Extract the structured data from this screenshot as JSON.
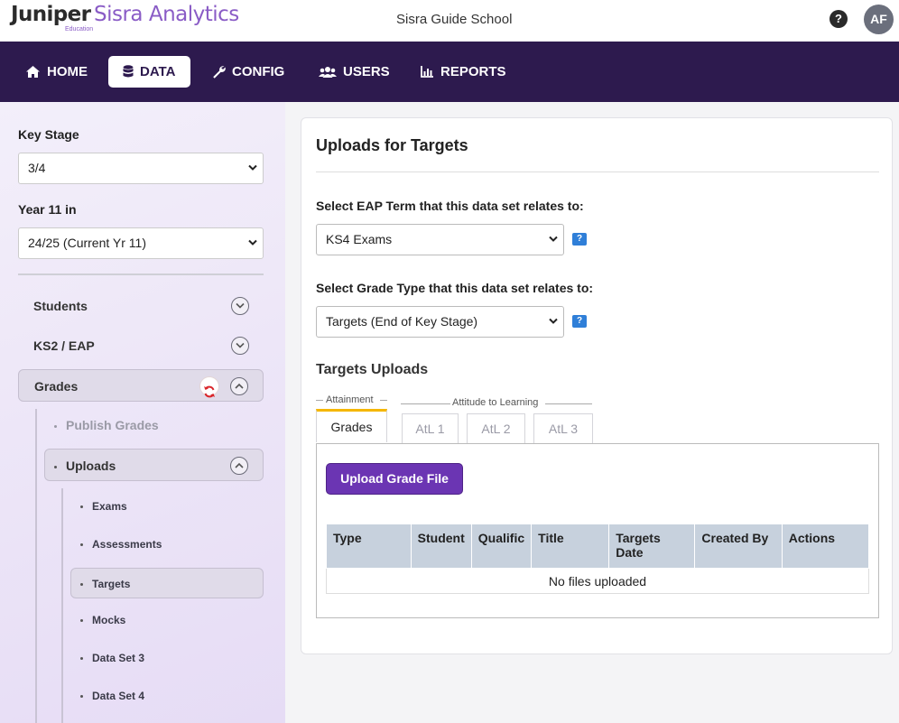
{
  "header": {
    "brand_name": "Juniper",
    "brand_sub": "Education",
    "app_name": "Sisra Analytics",
    "school_name": "Sisra Guide School",
    "help_label": "?",
    "avatar_initials": "AF"
  },
  "nav": {
    "items": [
      {
        "label": "HOME",
        "icon": "home-icon"
      },
      {
        "label": "DATA",
        "icon": "database-icon",
        "active": true
      },
      {
        "label": "CONFIG",
        "icon": "wrench-icon"
      },
      {
        "label": "USERS",
        "icon": "users-icon"
      },
      {
        "label": "REPORTS",
        "icon": "chart-icon"
      }
    ]
  },
  "sidebar": {
    "key_stage_label": "Key Stage",
    "key_stage_value": "3/4",
    "year_label": "Year 11 in",
    "year_value": "24/25 (Current Yr 11)",
    "sections": [
      {
        "label": "Students"
      },
      {
        "label": "KS2 / EAP"
      },
      {
        "label": "Grades",
        "open": true
      }
    ],
    "grades_children": {
      "publish": "Publish Grades",
      "uploads": "Uploads"
    },
    "uploads_children": [
      "Exams",
      "Assessments",
      "Targets",
      "Mocks",
      "Data Set 3",
      "Data Set 4"
    ],
    "active_leaf": "Targets"
  },
  "main": {
    "title": "Uploads for Targets",
    "eap_label": "Select EAP Term that this data set relates to:",
    "eap_value": "KS4 Exams",
    "grade_type_label": "Select Grade Type that this data set relates to:",
    "grade_type_value": "Targets (End of Key Stage)",
    "help_badge": "?",
    "section_title": "Targets Uploads",
    "group_attainment": "Attainment",
    "group_atl": "Attitude to Learning",
    "tabs": [
      "Grades",
      "AtL 1",
      "AtL 2",
      "AtL 3"
    ],
    "active_tab": "Grades",
    "upload_button": "Upload Grade File",
    "table": {
      "columns": [
        "Type",
        "Student",
        "Qualific",
        "Title",
        "Targets Date",
        "Created By",
        "Actions"
      ],
      "empty_message": "No files uploaded"
    }
  },
  "colors": {
    "nav_bg": "#2d1a4e",
    "brand_purple": "#8a5cc6",
    "primary_button": "#6b35b3",
    "tab_accent": "#f5b700",
    "table_header": "#c7d1dd",
    "help_badge": "#2f7fd8"
  }
}
